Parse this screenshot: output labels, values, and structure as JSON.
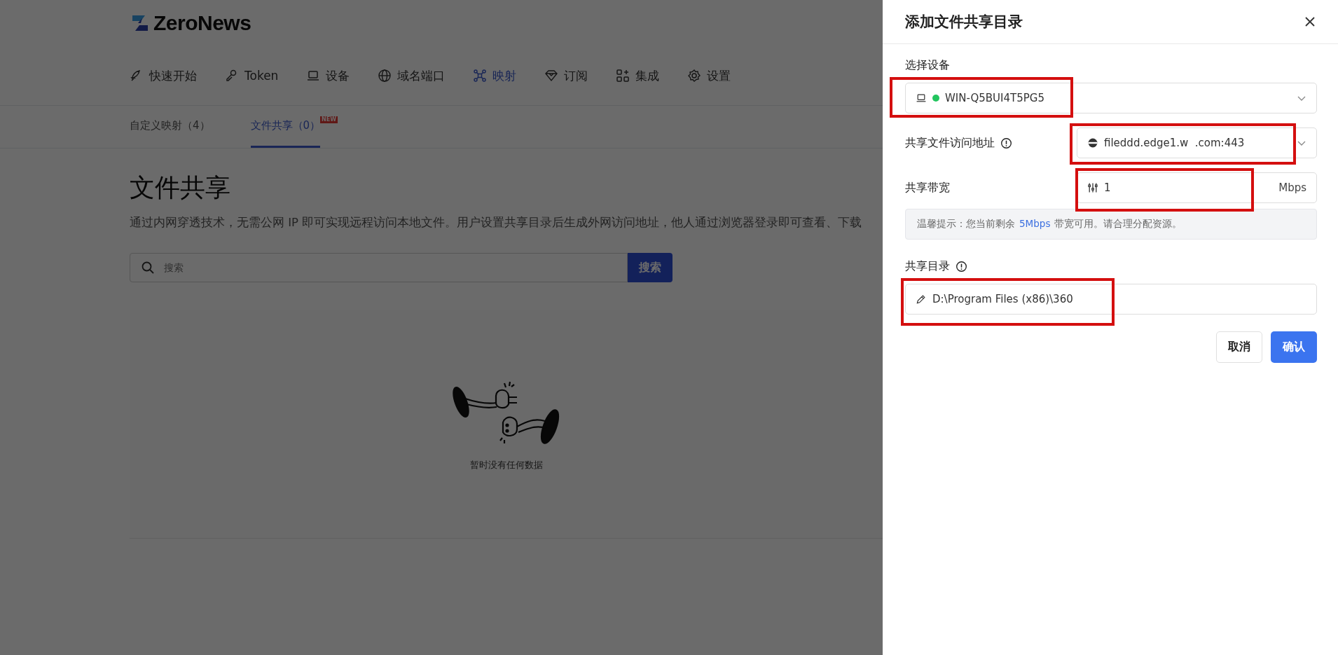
{
  "app": {
    "logo": "ZeroNews",
    "nav": [
      {
        "label": "快速开始",
        "selected": false
      },
      {
        "label": "Token",
        "selected": false
      },
      {
        "label": "设备",
        "selected": false
      },
      {
        "label": "域名端口",
        "selected": false
      },
      {
        "label": "映射",
        "selected": true
      },
      {
        "label": "订阅",
        "selected": false
      },
      {
        "label": "集成",
        "selected": false
      },
      {
        "label": "设置",
        "selected": false
      }
    ],
    "subtabs": [
      {
        "label": "自定义映射（4）",
        "selected": false
      },
      {
        "label": "文件共享（0）",
        "selected": true,
        "badge": "NEW"
      }
    ]
  },
  "page": {
    "title": "文件共享",
    "description": "通过内网穿透技术，无需公网 IP 即可实现远程访问本地文件。用户设置共享目录后生成外网访问地址，他人通过浏览器登录即可查看、下载",
    "search": {
      "placeholder": "搜索",
      "button": "搜索"
    },
    "empty": {
      "text": "暂时没有任何数据"
    }
  },
  "drawer": {
    "title": "添加文件共享目录",
    "fields": [
      {
        "kind": "device",
        "label": "选择设备",
        "info": false,
        "online": true,
        "value": "WIN-Q5BUI4T5PG5",
        "highlighted": true
      },
      {
        "kind": "address",
        "label": "共享文件访问地址",
        "info": true,
        "value": "fileddd.edge1.w  .com:443",
        "highlighted": true
      },
      {
        "kind": "bandwidth",
        "label": "共享带宽",
        "info": false,
        "value": "1",
        "suffix": "Mbps",
        "highlighted": true
      },
      {
        "kind": "tip",
        "prefix": "温馨提示：您当前剩余",
        "amount": "5Mbps",
        "suffix": "带宽可用。请合理分配资源。"
      },
      {
        "kind": "directory",
        "label": "共享目录",
        "info": true,
        "value": "D:\\Program Files (x86)\\360",
        "highlighted": true
      }
    ],
    "buttons": [
      {
        "kind": "secondary",
        "label": "取消"
      },
      {
        "kind": "primary",
        "label": "确认"
      }
    ]
  }
}
